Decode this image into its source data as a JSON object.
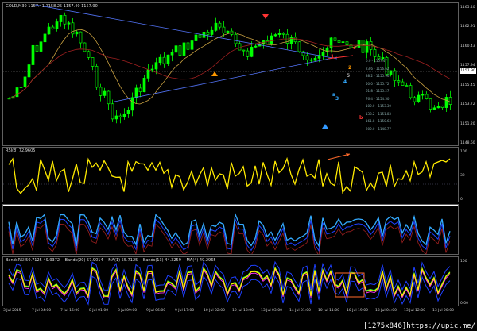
{
  "panes": {
    "price": {
      "label": "GOLD,M30  1157.41 1158.25 1157.40 1157.90",
      "axis_ticks": [
        "1165.40",
        "1162.91",
        "1160.43",
        "1157.94",
        "1155.45",
        "1153.72",
        "1151.20",
        "1148.60"
      ],
      "current_price": "1157.90",
      "wave_labels": [
        "a",
        "b",
        "c",
        "1",
        "2",
        "3",
        "4",
        "5"
      ],
      "fibo_levels": [
        "0.0 - 1157.47",
        "23.6 - 1156.62",
        "38.2 - 1155.96",
        "50.0 - 1155.72",
        "61.8 - 1155.27",
        "76.4 - 1154.50",
        "100.0 - 1153.30",
        "138.2 - 1151.83",
        "161.8 - 1150.63",
        "200.0 - 1148.77"
      ]
    },
    "rsi": {
      "label": "RSI(8) 72.9605",
      "axis_ticks": [
        "100",
        "32",
        "0"
      ]
    },
    "cci": {
      "label": "",
      "axis_ticks": []
    },
    "bands": {
      "label": "BandsRSI 50.7125  49.9372  —Bands(20) 57.9014  —MA(1) 55.7125  —Bands(13) 44.3259  —MA(4) 49.2965",
      "axis_ticks": [
        "100",
        "0.00"
      ]
    }
  },
  "time_axis": [
    "3 Jul 2015",
    "7 Jul 04:00",
    "7 Jul 16:00",
    "8 Jul 01:00",
    "8 Jul 09:00",
    "9 Jul 06:00",
    "9 Jul 17:00",
    "10 Jul 02:00",
    "10 Jul 18:00",
    "13 Jul 03:00",
    "14 Jul 01:00",
    "10 Jul 11:00",
    "10 Jul 19:00",
    "13 Jul 04:00",
    "13 Jul 12:00",
    "13 Jul 20:00"
  ],
  "watermark": "[1275x846]https://upic.me/",
  "colors": {
    "bull": "#00ff00",
    "bear": "#00ff00",
    "rsi": "#ffea00",
    "cci": "#33aaff",
    "ma": "#ff3333",
    "bands": "#1e40ff",
    "accent": "#ff6a2b"
  }
}
